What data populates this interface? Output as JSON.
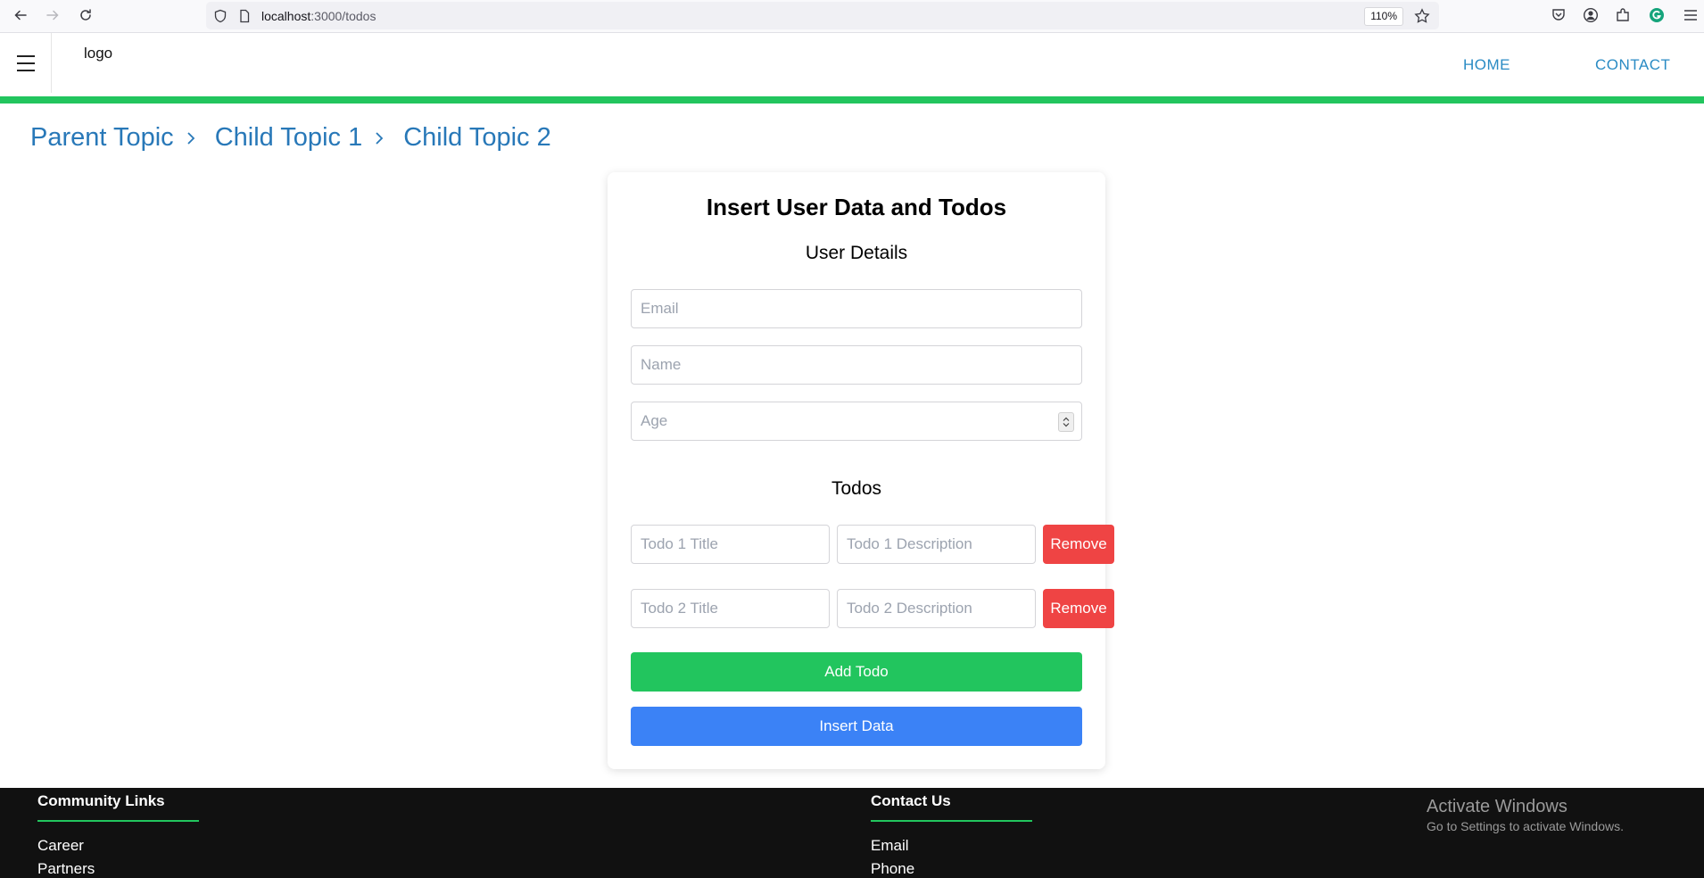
{
  "browser": {
    "url_host": "localhost",
    "url_path": ":3000/todos",
    "zoom": "110%"
  },
  "header": {
    "logo": "logo",
    "nav": [
      "HOME",
      "CONTACT"
    ]
  },
  "breadcrumb": [
    "Parent Topic",
    "Child Topic 1",
    "Child Topic 2"
  ],
  "form": {
    "title": "Insert User Data and Todos",
    "user_section": "User Details",
    "email_placeholder": "Email",
    "name_placeholder": "Name",
    "age_placeholder": "Age",
    "todos_section": "Todos",
    "todos": [
      {
        "title_placeholder": "Todo 1 Title",
        "desc_placeholder": "Todo 1 Description",
        "remove_label": "Remove"
      },
      {
        "title_placeholder": "Todo 2 Title",
        "desc_placeholder": "Todo 2 Description",
        "remove_label": "Remove"
      }
    ],
    "add_todo_label": "Add Todo",
    "insert_label": "Insert Data"
  },
  "footer": {
    "community": {
      "heading": "Community Links",
      "links": [
        "Career",
        "Partners"
      ]
    },
    "contact": {
      "heading": "Contact Us",
      "links": [
        "Email",
        "Phone"
      ]
    }
  },
  "watermark": {
    "line1": "Activate Windows",
    "line2": "Go to Settings to activate Windows."
  },
  "colors": {
    "accent_green": "#22c55e",
    "danger_red": "#ef4444",
    "primary_blue": "#3b82f6",
    "link_blue": "#2878b8"
  }
}
